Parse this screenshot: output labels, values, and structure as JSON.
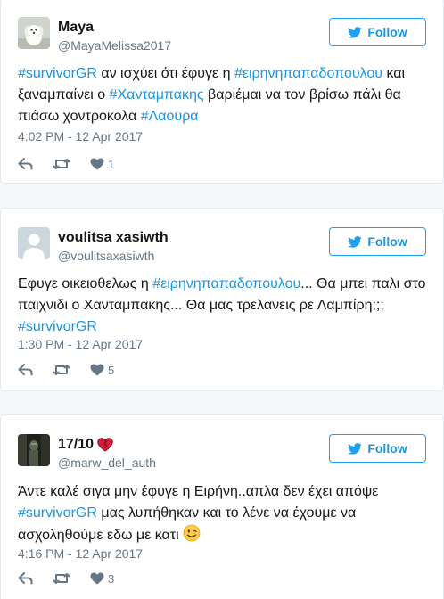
{
  "colors": {
    "link": "#1b95e0",
    "muted": "#657786",
    "icon": "#aab8c2",
    "heart_emoji": "#e0245e"
  },
  "follow_label": "Follow",
  "tweets": [
    {
      "name": "Maya",
      "handle": "@MayaMelissa2017",
      "segments": [
        {
          "t": "#survivorGR",
          "tag": true
        },
        {
          "t": " αν ισχύει ότι έφυγε η ",
          "tag": false
        },
        {
          "t": "#ειρηνηπαπαδοπουλου",
          "tag": true
        },
        {
          "t": " και ξαναμπαίνει ο ",
          "tag": false
        },
        {
          "t": "#Χανταμπακης",
          "tag": true
        },
        {
          "t": " βαριέμαι να τον βρίσω πάλι θα πιάσω χοντροκολα ",
          "tag": false
        },
        {
          "t": "#Λαουρα",
          "tag": true
        }
      ],
      "timestamp": "4:02 PM - 12 Apr 2017",
      "likes": "1",
      "avatar_icon": "puppy-avatar-icon"
    },
    {
      "name": "voulitsa xasiwth",
      "handle": "@voulitsaxasiwth",
      "segments": [
        {
          "t": "Εφυγε οικειοθελως η ",
          "tag": false
        },
        {
          "t": "#ειρηνηπαπαδοπουλου",
          "tag": true
        },
        {
          "t": "... Θα μπει παλι στο παιχνιδι ο Χανταμπακης... Θα μας τρελανεις ρε Λαμπίρη;;; ",
          "tag": false
        },
        {
          "t": "#survivorGR",
          "tag": true
        }
      ],
      "timestamp": "1:30 PM - 12 Apr 2017",
      "likes": "5",
      "avatar_icon": "default-user-avatar-icon"
    },
    {
      "name": "17/10",
      "name_emoji": "heart-emoji-icon",
      "handle": "@marw_del_auth",
      "segments": [
        {
          "t": "Άντε καλέ σιγα μην έφυγε η Ειρήνη..απλα δεν έχει απόψε ",
          "tag": false
        },
        {
          "t": "#survivorGR",
          "tag": true
        },
        {
          "t": " μας λυπήθηκαν και το λένε να έχουμε να ασχοληθούμε εδω με κατι ",
          "tag": false
        }
      ],
      "text_emoji": "winking-face-emoji-icon",
      "timestamp": "4:16 PM - 12 Apr 2017",
      "likes": "3",
      "avatar_icon": "dark-photo-avatar-icon"
    }
  ]
}
